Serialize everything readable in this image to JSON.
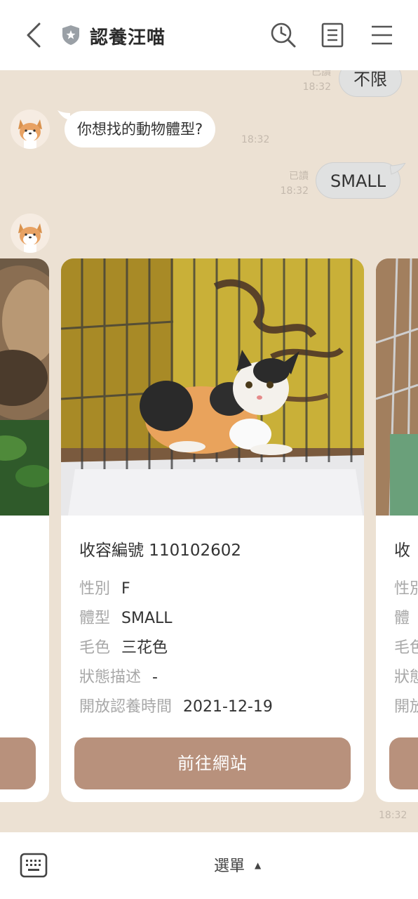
{
  "header": {
    "title": "認養汪喵"
  },
  "messages": {
    "prev_out": {
      "text": "不限",
      "read": "已讀",
      "time": "18:32"
    },
    "bot_question": {
      "text": "你想找的動物體型?",
      "time": "18:32"
    },
    "user_reply": {
      "text": "SMALL",
      "read": "已讀",
      "time": "18:32"
    },
    "carousel_time": "18:32"
  },
  "carousel": {
    "main_card": {
      "title": "收容編號 110102602",
      "rows": [
        {
          "label": "性別",
          "value": "F"
        },
        {
          "label": "體型",
          "value": "SMALL"
        },
        {
          "label": "毛色",
          "value": "三花色"
        },
        {
          "label": "狀態描述",
          "value": "-"
        },
        {
          "label": "開放認養時間",
          "value": "2021-12-19"
        }
      ],
      "button_label": "前往網站"
    },
    "next_card": {
      "title_fragment": "收",
      "row_fragments": [
        "性別",
        "體",
        "毛色",
        "狀態",
        "開放"
      ]
    }
  },
  "footer": {
    "menu_label": "選單",
    "menu_caret": "▲"
  },
  "colors": {
    "background": "#ece1d3",
    "button": "#b8917c",
    "bubble_out": "#e0e1e1"
  },
  "icons": [
    "back-arrow-icon",
    "shield-icon",
    "search-clock-icon",
    "notes-icon",
    "hamburger-menu-icon",
    "keyboard-icon",
    "shiba-avatar-icon"
  ]
}
